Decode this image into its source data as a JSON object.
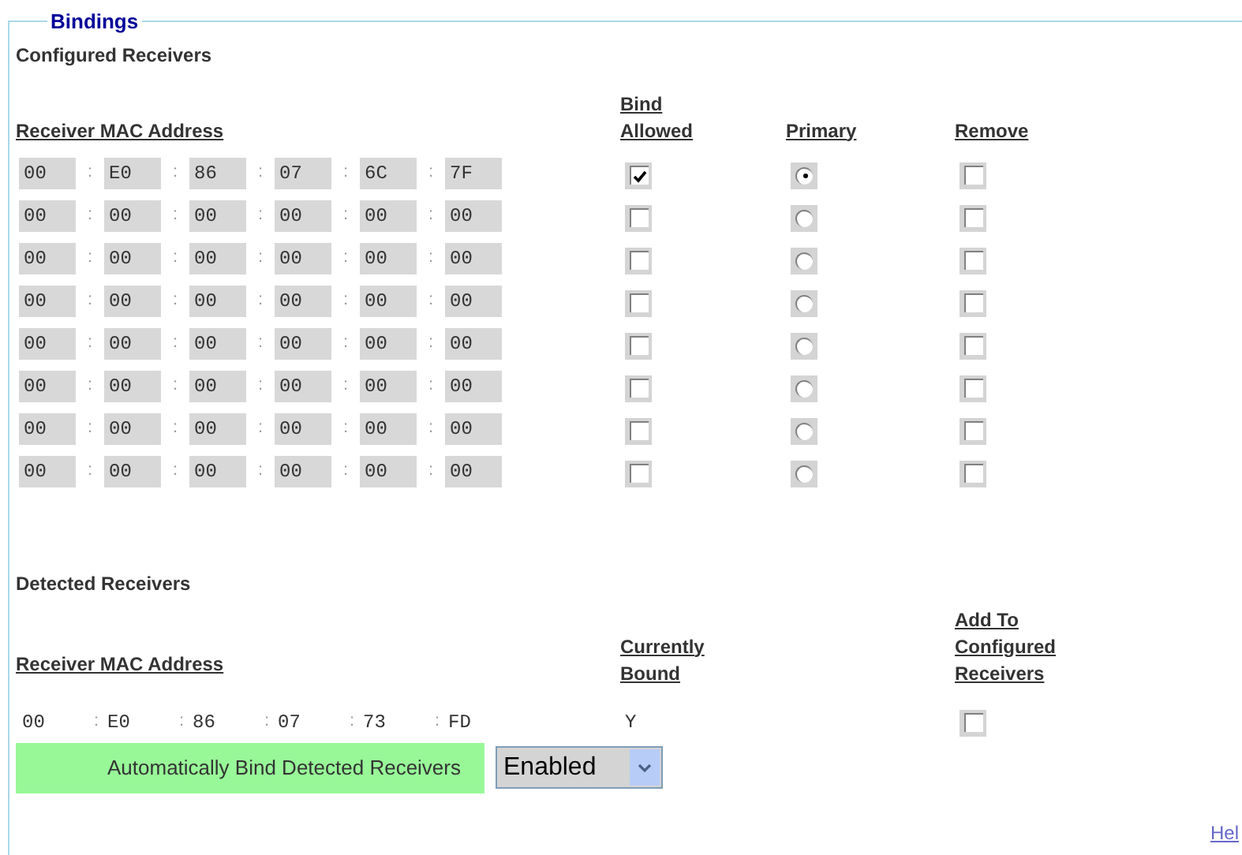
{
  "legend": "Bindings",
  "configured": {
    "title": "Configured Receivers",
    "columns": [
      "Receiver MAC Address",
      "Bind Allowed",
      "Primary",
      "Remove"
    ],
    "separator": ":",
    "rows": [
      {
        "octets": [
          "00",
          "E0",
          "86",
          "07",
          "6C",
          "7F"
        ],
        "bind_allowed": true,
        "selected": true,
        "remove": false
      },
      {
        "octets": [
          "00",
          "00",
          "00",
          "00",
          "00",
          "00"
        ],
        "bind_allowed": false,
        "selected": false,
        "remove": false
      },
      {
        "octets": [
          "00",
          "00",
          "00",
          "00",
          "00",
          "00"
        ],
        "bind_allowed": false,
        "selected": false,
        "remove": false
      },
      {
        "octets": [
          "00",
          "00",
          "00",
          "00",
          "00",
          "00"
        ],
        "bind_allowed": false,
        "selected": false,
        "remove": false
      },
      {
        "octets": [
          "00",
          "00",
          "00",
          "00",
          "00",
          "00"
        ],
        "bind_allowed": false,
        "selected": false,
        "remove": false
      },
      {
        "octets": [
          "00",
          "00",
          "00",
          "00",
          "00",
          "00"
        ],
        "bind_allowed": false,
        "selected": false,
        "remove": false
      },
      {
        "octets": [
          "00",
          "00",
          "00",
          "00",
          "00",
          "00"
        ],
        "bind_allowed": false,
        "selected": false,
        "remove": false
      },
      {
        "octets": [
          "00",
          "00",
          "00",
          "00",
          "00",
          "00"
        ],
        "bind_allowed": false,
        "selected": false,
        "remove": false
      }
    ]
  },
  "detected": {
    "title": "Detected Receivers",
    "columns": [
      "Receiver MAC Address",
      "Currently Bound",
      "Add To Configured Receivers"
    ],
    "separator": ":",
    "rows": [
      {
        "octets": [
          "00",
          "E0",
          "86",
          "07",
          "73",
          "FD"
        ],
        "bound": "Y",
        "add": false
      }
    ]
  },
  "auto_bind": {
    "label": "Automatically Bind Detected Receivers",
    "value": "Enabled"
  },
  "help_link": "Hel"
}
